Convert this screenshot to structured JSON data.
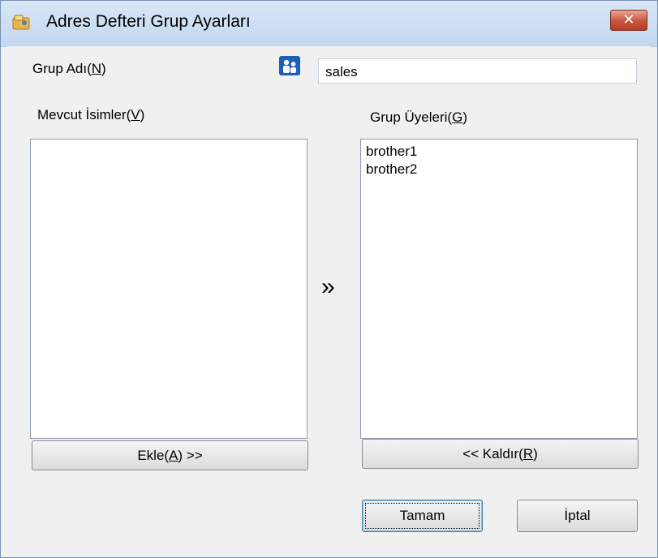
{
  "window": {
    "title": "Adres Defteri Grup Ayarları",
    "close_symbol": "✕"
  },
  "group_name": {
    "label_prefix": "Grup Adı(",
    "label_key": "N",
    "label_suffix": ")",
    "value": "sales",
    "icon": "group-users-icon"
  },
  "available_names": {
    "label_prefix": "Mevcut İsimler(",
    "label_key": "V",
    "label_suffix": ")",
    "items": []
  },
  "group_members": {
    "label_prefix": "Grup Üyeleri(",
    "label_key": "G",
    "label_suffix": ")",
    "items": [
      "brother1",
      "brother2"
    ]
  },
  "transfer_symbol": "»",
  "buttons": {
    "add_prefix": "Ekle(",
    "add_key": "A",
    "add_suffix": ") >>",
    "remove_prefix": "<< Kaldır(",
    "remove_key": "R",
    "remove_suffix": ")",
    "ok": "Tamam",
    "cancel": "İptal"
  },
  "colors": {
    "accent": "#1d5fb4",
    "close": "#c8533d"
  }
}
